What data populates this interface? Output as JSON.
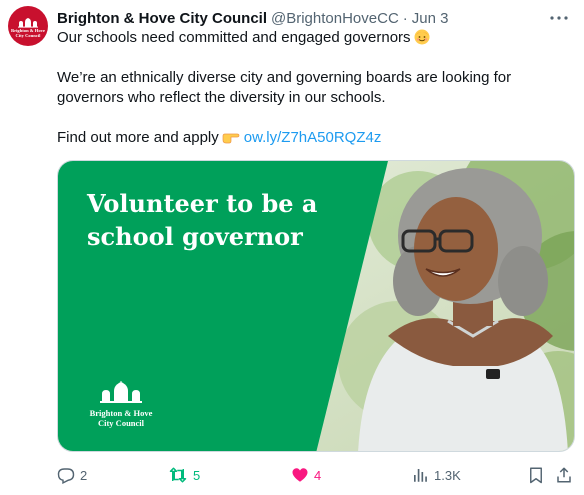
{
  "tweet": {
    "author": {
      "name": "Brighton & Hove City Council",
      "handle": "@BrightonHoveCC",
      "avatar_text": "Brighton & Hove City Council",
      "avatar_color": "#c8102e"
    },
    "separator": "·",
    "date": "Jun 3",
    "text": {
      "line1": "Our schools need committed and engaged governors",
      "line1_emoji": "smiling-face-emoji",
      "paragraph2": "We’re an ethnically diverse city and governing boards are looking for governors who reflect the diversity in our schools.",
      "paragraph3_prefix": "Find out more and apply",
      "paragraph3_emoji": "pointing-hand-emoji",
      "link": "ow.ly/Z7hA50RQZ4z"
    },
    "media": {
      "headline": "Volunteer to be a school governor",
      "logo_text": "Brighton & Hove City Council",
      "panel_color": "#00a05a"
    },
    "actions": {
      "replies": "2",
      "retweets": "5",
      "likes": "4",
      "views": "1.3K"
    },
    "colors": {
      "link": "#1d9bf0",
      "retweet_active": "#00ba7c",
      "like_active": "#f91880",
      "muted": "#536471"
    }
  }
}
